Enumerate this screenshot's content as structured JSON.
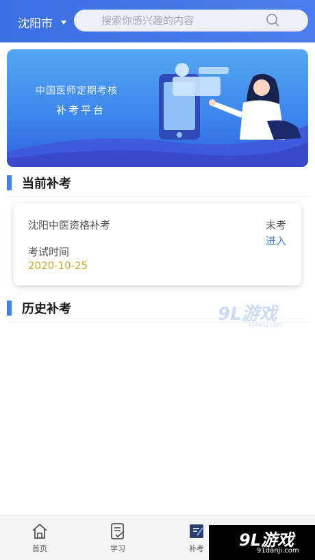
{
  "header": {
    "city": "沈阳市",
    "search_placeholder": "搜索你感兴趣的内容"
  },
  "banner": {
    "line1": "中国医师定期考核",
    "line2": "补考平台"
  },
  "current_section": {
    "title": "当前补考"
  },
  "exam_card": {
    "name": "沈阳中医资格补考",
    "status": "未考",
    "action": "进入",
    "time_label": "考试时间",
    "date": "2020-10-25"
  },
  "history_section": {
    "title": "历史补考"
  },
  "watermark": {
    "text": "9L游戏",
    "sub": "91danji.com"
  },
  "nav": {
    "items": [
      {
        "label": "首页",
        "icon": "home-icon"
      },
      {
        "label": "学习",
        "icon": "study-icon"
      },
      {
        "label": "补考",
        "icon": "retake-icon"
      }
    ],
    "overlay_big": "9L游戏",
    "overlay_small": "91danji.com"
  },
  "colors": {
    "primary": "#3f7ff0",
    "date": "#d4a62a"
  }
}
